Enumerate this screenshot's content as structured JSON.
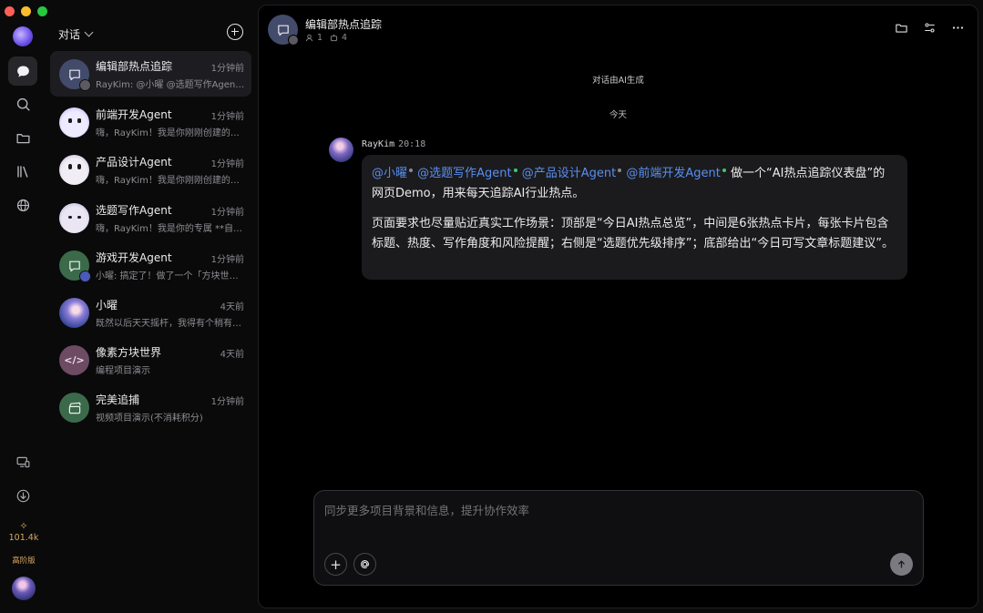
{
  "window": {
    "controls": [
      "close",
      "minimize",
      "zoom"
    ]
  },
  "rail": {
    "items": [
      {
        "icon": "chat-bubble-icon",
        "active": true
      },
      {
        "icon": "search-icon"
      },
      {
        "icon": "folder-icon"
      },
      {
        "icon": "library-icon"
      },
      {
        "icon": "globe-icon"
      },
      {
        "icon": "device-switch-icon"
      },
      {
        "icon": "download-icon"
      }
    ],
    "credits": {
      "icon": "sparkle-icon",
      "value": "101.4k",
      "tier": "高阶版"
    }
  },
  "sidebar": {
    "title": "对话",
    "conversations": [
      {
        "name": "编辑部热点追踪",
        "time": "1分钟前",
        "preview": "RayKim: @小曜 @选题写作Agent @产品设计Agent",
        "avatar": "group-chat",
        "selected": true
      },
      {
        "name": "前端开发Agent",
        "time": "1分钟前",
        "preview": "嗨，RayKim！我是你刚刚创建的前端开发Agent",
        "avatar": "blob1"
      },
      {
        "name": "产品设计Agent",
        "time": "1分钟前",
        "preview": "嗨，RayKim！我是你刚刚创建的产品设计Agent",
        "avatar": "blob2"
      },
      {
        "name": "选题写作Agent",
        "time": "1分钟前",
        "preview": "嗨，RayKim！我是你的专属 **自媒体选题",
        "avatar": "blob3"
      },
      {
        "name": "游戏开发Agent",
        "time": "1分钟前",
        "preview": "小曜: 搞定了！做了一个「方块世界」",
        "avatar": "green-chat"
      },
      {
        "name": "小曜",
        "time": "4天前",
        "preview": "既然以后天天摇杆，我得有个稍有点样子",
        "avatar": "girl"
      },
      {
        "name": "像素方块世界",
        "time": "4天前",
        "preview": "编程项目演示",
        "avatar": "code"
      },
      {
        "name": "完美追捕",
        "time": "1分钟前",
        "preview": "视频项目演示(不消耗积分)",
        "avatar": "video"
      }
    ]
  },
  "chat": {
    "title": "编辑部热点追踪",
    "members": "1",
    "agents": "4",
    "system_note": "对话由AI生成",
    "date_separator": "今天",
    "message": {
      "author": "RayKim",
      "time": "20:18",
      "mentions": [
        {
          "text": "@小曜",
          "status": "gray"
        },
        {
          "text": "@选题写作Agent",
          "status": "green"
        },
        {
          "text": "@产品设计Agent",
          "status": "gray"
        },
        {
          "text": "@前端开发Agent",
          "status": "green"
        }
      ],
      "line1_rest": "做一个“AI热点追踪仪表盘”的网页Demo，用来每天追踪AI行业热点。",
      "paragraph2": "页面要求也尽量贴近真实工作场景：顶部是“今日AI热点总览”，中间是6张热点卡片，每张卡片包含标题、热度、写作角度和风险提醒；右侧是“选题优先级排序”；底部给出“今日可写文章标题建议”。"
    },
    "composer": {
      "placeholder": "同步更多项目背景和信息，提升协作效率"
    }
  },
  "colors": {
    "mention": "#5a8ff0",
    "online": "#3ec86a",
    "credits": "#d8a861"
  }
}
